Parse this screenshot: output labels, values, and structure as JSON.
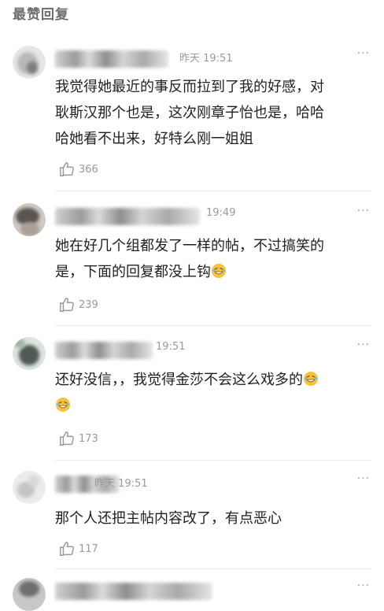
{
  "header": {
    "title": "最赞回复"
  },
  "comments": [
    {
      "time": "昨天 19:51",
      "text_lines": [
        "我觉得她最近的事反而拉到了我的好感，对",
        "耿斯汉那个也是，这次刚章子怡也是，哈哈",
        "哈她看不出来，好特么刚一姐姐"
      ],
      "likes": "366",
      "more": "···"
    },
    {
      "time": "19:49",
      "text_lines": [
        "她在好几个组都发了一样的帖，不过搞笑的",
        "是，下面的回复都没上钩"
      ],
      "likes": "239",
      "more": "···"
    },
    {
      "time": "19:51",
      "text_lines": [
        "还好没信，，我觉得金莎不会这么戏多的",
        ""
      ],
      "likes": "173",
      "more": "···"
    },
    {
      "time": "昨天 19:51",
      "text_lines": [
        "那个人还把主帖内容改了，有点恶心"
      ],
      "likes": "117",
      "more": "···"
    },
    {
      "time": "",
      "text_lines": [],
      "likes": "",
      "more": "···"
    }
  ]
}
